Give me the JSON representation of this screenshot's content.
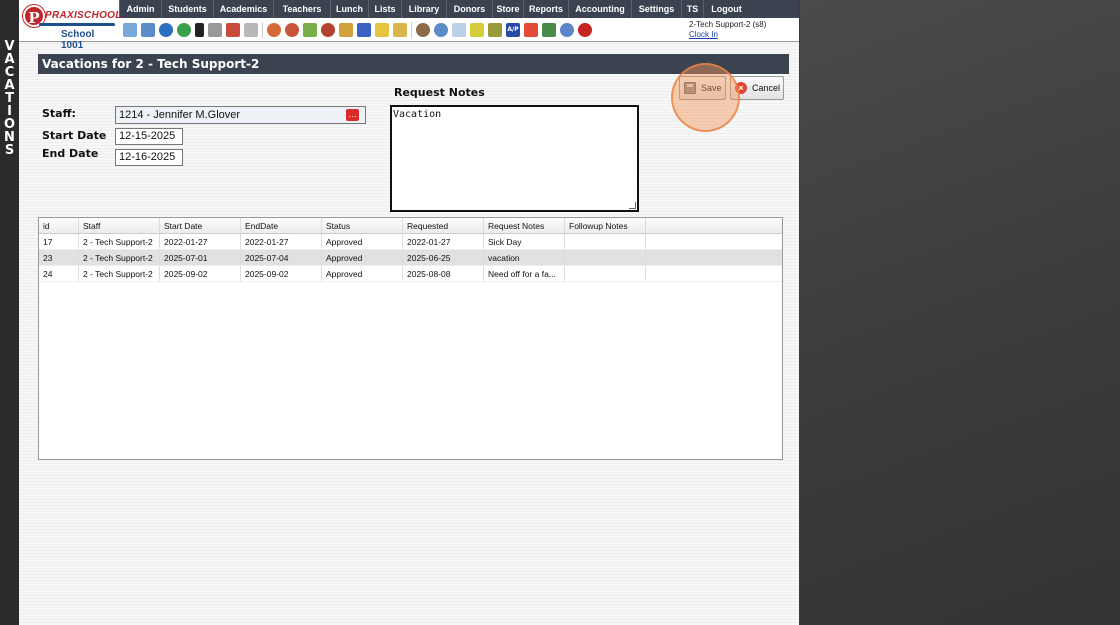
{
  "side_label": "VACATIONS",
  "logo": {
    "brand": "PRAXISCHOOL",
    "mark": "P",
    "school": "School 1001"
  },
  "menu": [
    "Admin",
    "Students",
    "Academics",
    "Teachers",
    "Lunch",
    "Lists",
    "Library",
    "Donors",
    "Store",
    "Reports",
    "Accounting",
    "Settings",
    "TS",
    "Logout"
  ],
  "user": {
    "name": "2-Tech Support-2 (s8)",
    "clock_in": "Clock In"
  },
  "page": {
    "title": "Vacations for 2 - Tech Support-2"
  },
  "form": {
    "staff_label": "Staff:",
    "staff_value": "1214 - Jennifer M.Glover",
    "staff_lookup_icon": "…",
    "start_label": "Start Date",
    "start_value": "12-15-2025",
    "end_label": "End Date",
    "end_value": "12-16-2025",
    "notes_label": "Request Notes",
    "notes_value": "Vacation"
  },
  "buttons": {
    "save": "Save",
    "cancel": "Cancel",
    "cancel_icon": "×"
  },
  "table": {
    "columns": [
      "id",
      "Staff",
      "Start Date",
      "EndDate",
      "Status",
      "Requested",
      "Request Notes",
      "Followup Notes"
    ],
    "rows": [
      [
        "17",
        "2 - Tech Support-2",
        "2022-01-27",
        "2022-01-27",
        "Approved",
        "2022-01-27",
        "Sick Day",
        ""
      ],
      [
        "23",
        "2 - Tech Support-2",
        "2025-07-01",
        "2025-07-04",
        "Approved",
        "2025-06-25",
        "vacation",
        ""
      ],
      [
        "24",
        "2 - Tech Support-2",
        "2025-09-02",
        "2025-09-02",
        "Approved",
        "2025-08-08",
        "Need off for a fa...",
        ""
      ]
    ]
  },
  "colors": {
    "header_dark": "#3b4350",
    "brand_red": "#c0262c",
    "brand_blue": "#1f4e8c",
    "highlight": "#f5965a"
  }
}
